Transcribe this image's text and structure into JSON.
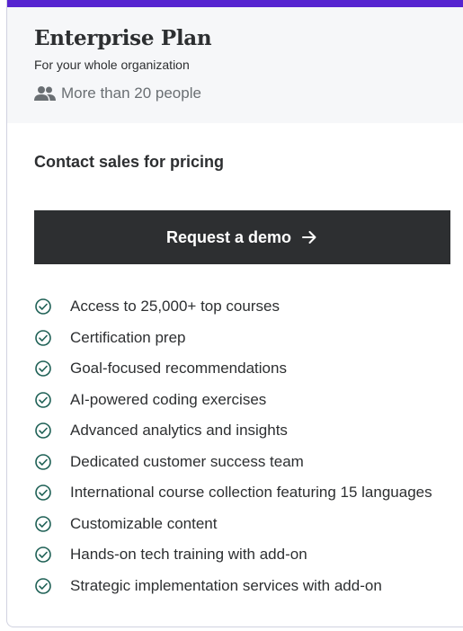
{
  "plan": {
    "title": "Enterprise Plan",
    "subtitle": "For your whole organization",
    "audience": "More than 20 people",
    "pricing_text": "Contact sales for pricing",
    "cta_label": "Request a demo"
  },
  "icons": {
    "audience": "people-icon",
    "cta": "arrow-right-icon",
    "feature": "check-circle-icon"
  },
  "colors": {
    "accent": "#5624d0",
    "button": "#2d2f31",
    "check": "#1e6055",
    "header_bg": "#f6f7f9"
  },
  "features": [
    "Access to 25,000+ top courses",
    "Certification prep",
    "Goal-focused recommendations",
    "AI-powered coding exercises",
    "Advanced analytics and insights",
    "Dedicated customer success team",
    "International course collection featuring 15 languages",
    "Customizable content",
    "Hands-on tech training with add-on",
    "Strategic implementation services with add-on"
  ]
}
